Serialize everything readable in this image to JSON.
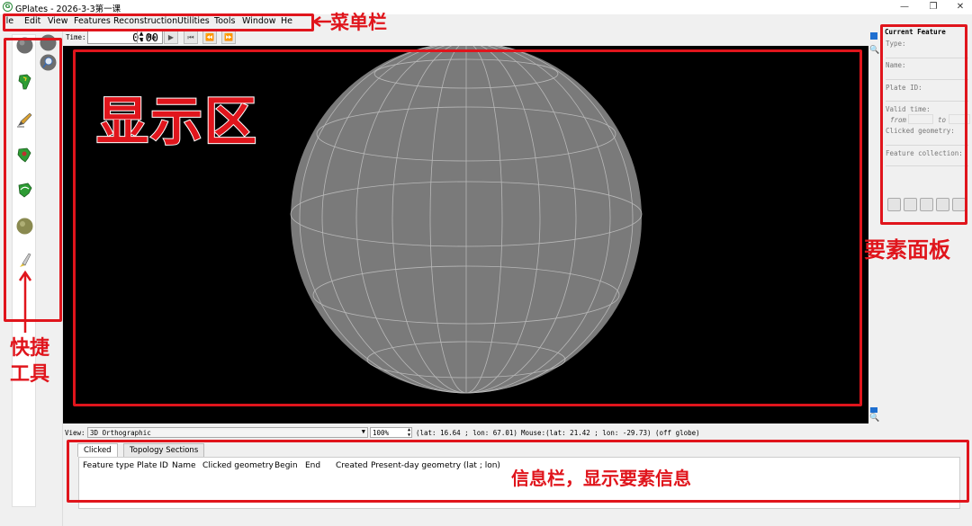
{
  "window": {
    "title": "GPlates - 2026-3-3第一课",
    "icon_letter": "G",
    "minimize": "—",
    "maximize": "❐",
    "close": "✕"
  },
  "menu": [
    "ile",
    "Edit",
    "View",
    "Features",
    "Reconstruction",
    "Utilities",
    "Tools",
    "Window",
    "He"
  ],
  "time_bar": {
    "label": "Time:",
    "value": "0.00",
    "unit": "Ma"
  },
  "feature_panel": {
    "title": "Current Feature",
    "type_label": "Type:",
    "name_label": "Name:",
    "plate_id_label": "Plate ID:",
    "valid_time_label": "Valid time:",
    "from_label": "from",
    "to_label": "to",
    "clicked_geometry_label": "Clicked geometry:",
    "feature_collection_label": "Feature collection:"
  },
  "status_bar": {
    "view_label": "View:",
    "projection": "3D Orthographic",
    "zoom": "100%",
    "camera": "(lat: 16.64 ; lon: 67.01)",
    "mouse": "Mouse:(lat: 21.42 ; lon: -29.73) (off globe)"
  },
  "info_panel": {
    "tabs": [
      "Clicked",
      "Topology Sections"
    ],
    "columns": [
      "Feature type",
      "Plate ID",
      "Name",
      "Clicked geometry",
      "Begin",
      "End",
      "Created",
      "Present-day geometry (lat ; lon)"
    ]
  },
  "annotations": {
    "menu_bar": "菜单栏",
    "display_area": "显示区",
    "feature_panel": "要素面板",
    "shortcut_tools_line1": "快捷",
    "shortcut_tools_line2": "工具",
    "info_bar": "信息栏，显示要素信息"
  },
  "colors": {
    "annotation_red": "#e0151c",
    "globe_fill": "#777777",
    "viewport_bg": "#000000"
  }
}
